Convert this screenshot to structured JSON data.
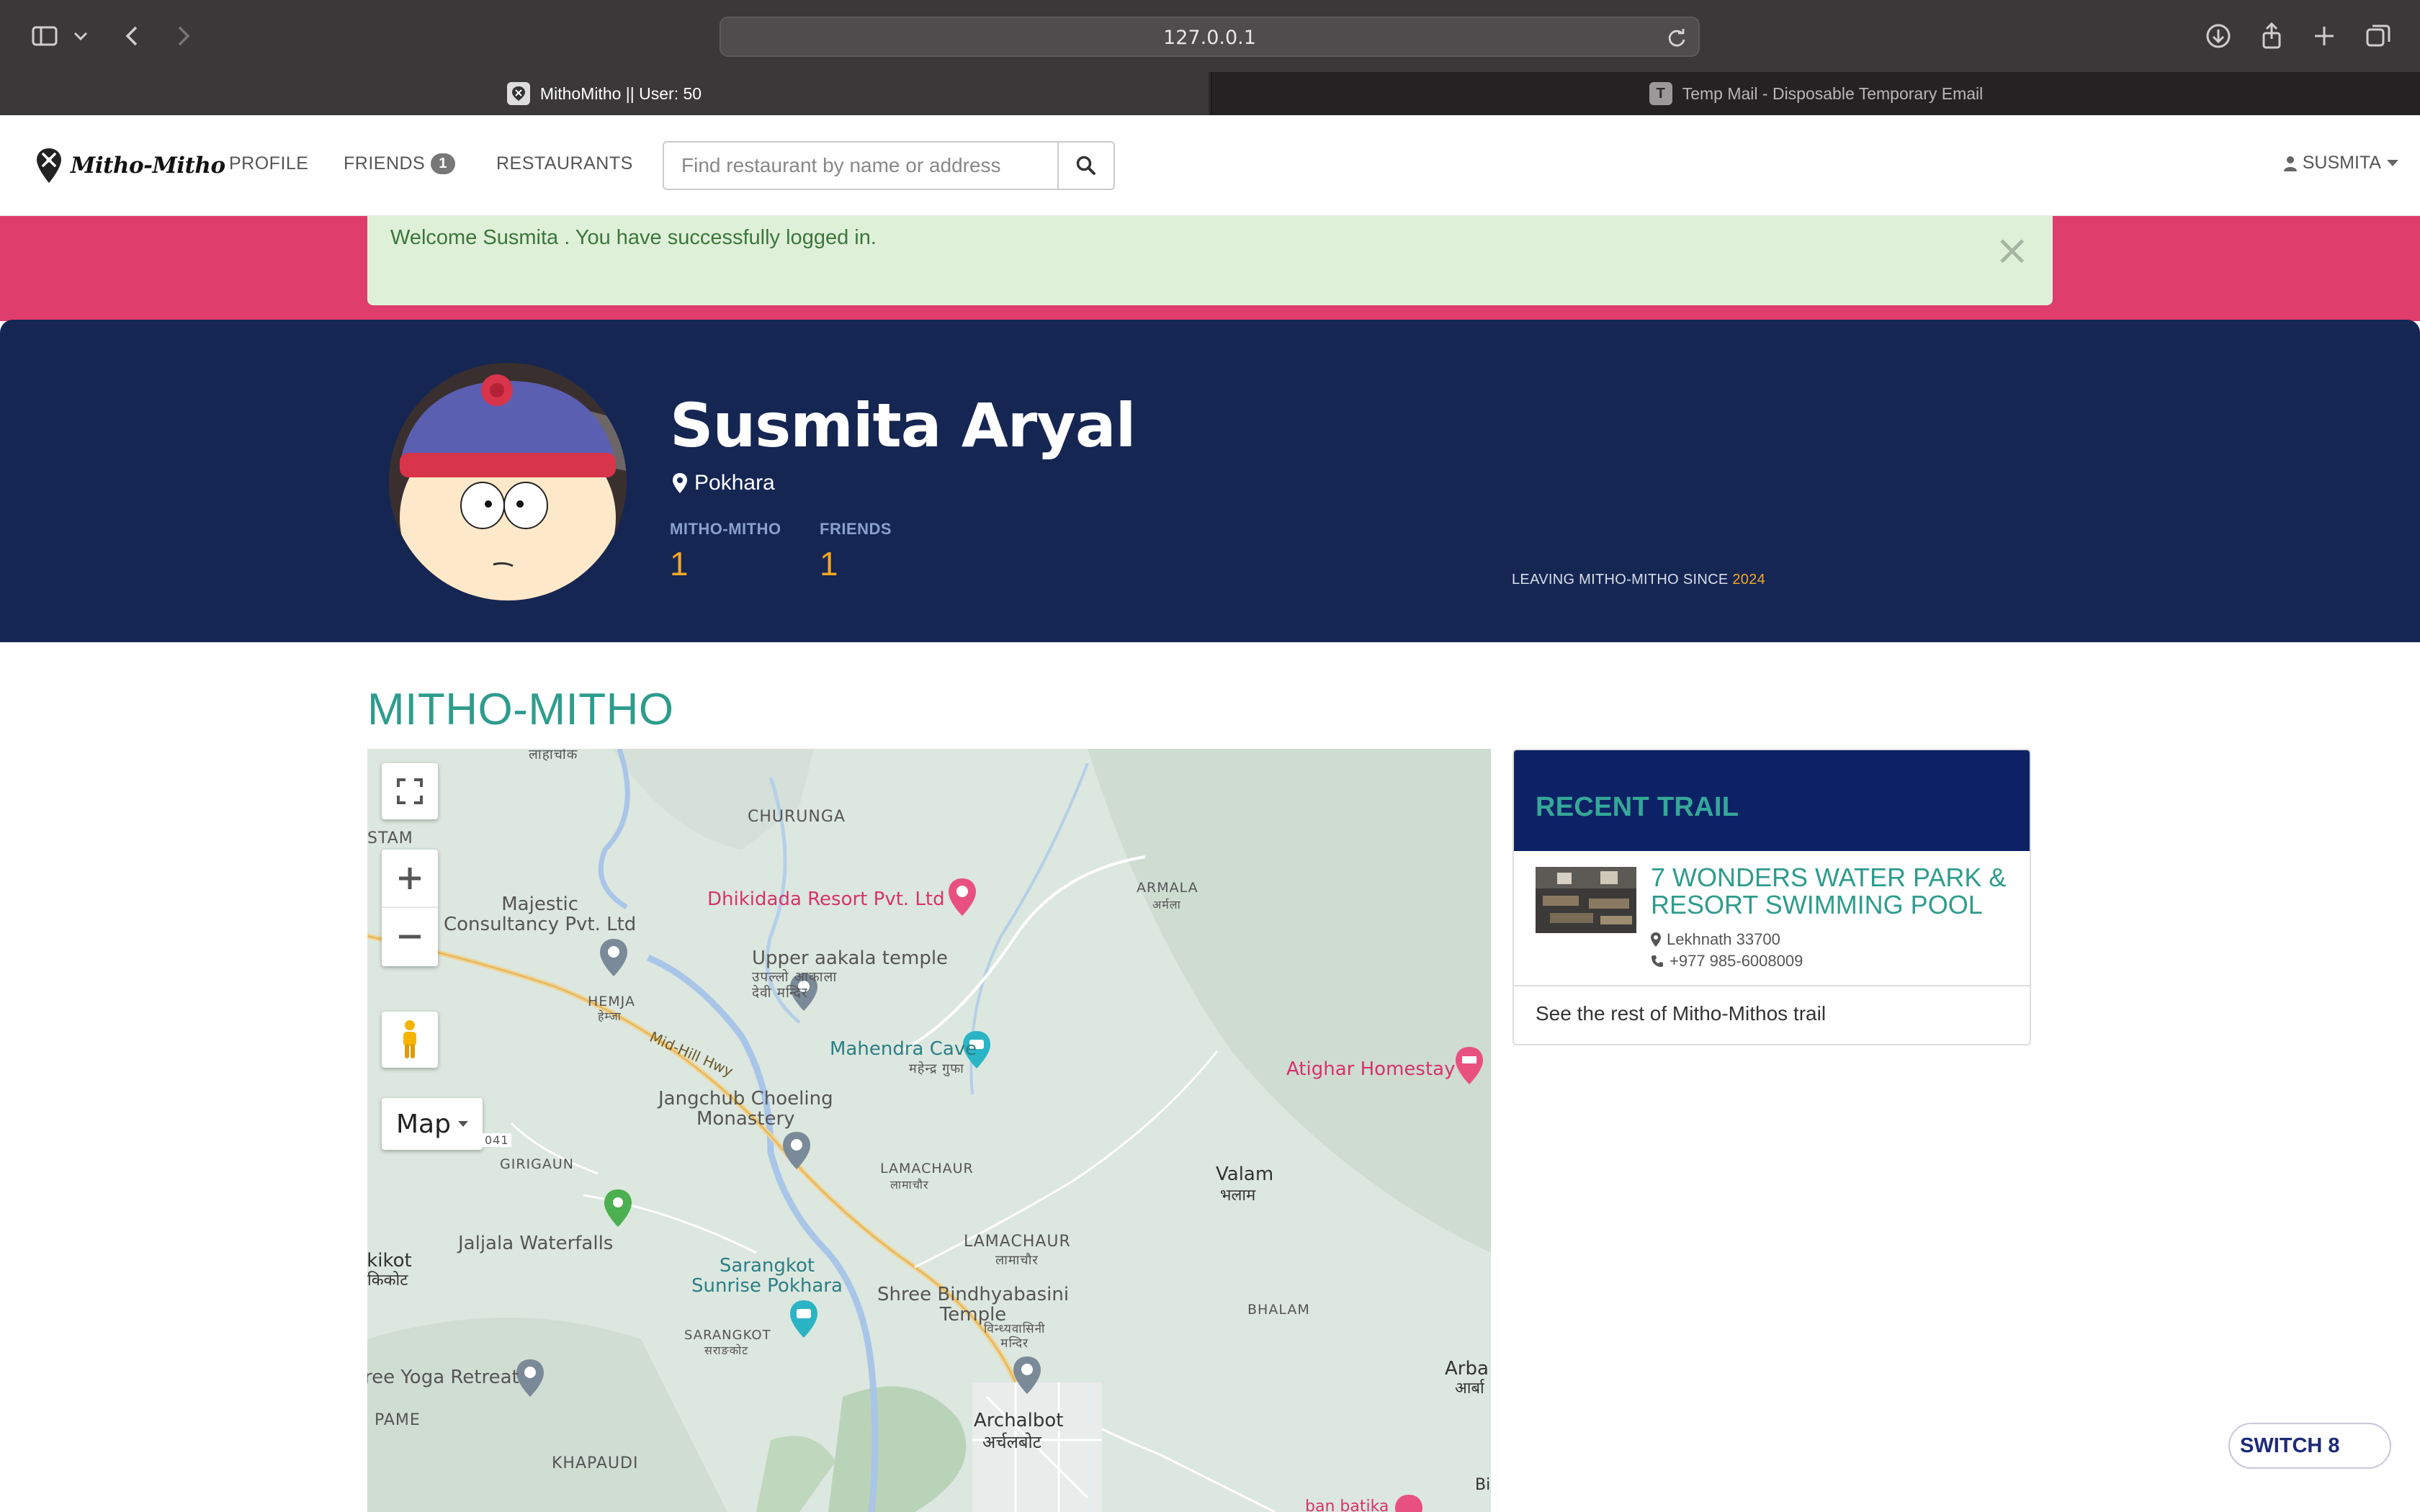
{
  "browser": {
    "url": "127.0.0.1",
    "tabs": [
      {
        "title": "MithoMitho || User: 50",
        "active": true
      },
      {
        "title": "Temp Mail - Disposable Temporary Email",
        "active": false,
        "favicon_letter": "T"
      }
    ]
  },
  "navbar": {
    "brand": "Mitho-Mitho",
    "links": {
      "profile": "PROFILE",
      "friends": "FRIENDS",
      "restaurants": "RESTAURANTS"
    },
    "friends_badge": "1",
    "search_placeholder": "Find restaurant by name or address",
    "user": "SUSMITA"
  },
  "alert": {
    "message": "Welcome Susmita . You have successfully logged in.",
    "close": "×"
  },
  "profile": {
    "name": "Susmita Aryal",
    "location": "Pokhara",
    "stats": [
      {
        "label": "MITHO-MITHO",
        "value": "1"
      },
      {
        "label": "FRIENDS",
        "value": "1"
      }
    ],
    "since_text": "LEAVING MITHO-MITHO SINCE",
    "since_year": "2024"
  },
  "section": {
    "title": "MITHO-MITHO"
  },
  "map": {
    "type_button": "Map",
    "labels": {
      "lahachok": "लाहाचोक",
      "churunga": "CHURUNGA",
      "stam": "STAM",
      "majestic": "Majestic\nConsultancy Pvt. Ltd",
      "dhikidada": "Dhikidada Resort Pvt. Ltd",
      "armala": "ARMALA",
      "armala_dev": "अर्मला",
      "upper_aakala": "Upper aakala temple",
      "upper_aakala_dev": "उपल्लो आकाला\nदेवी मन्दिर",
      "hemja": "HEMJA",
      "hemja_dev": "हेम्जा",
      "mahendra_cave": "Mahendra Cave",
      "mahendra_cave_dev": "महेन्द्र गुफा",
      "mid_hill": "Mid-Hill Hwy",
      "atighar": "Atighar Homestay",
      "jangchub": "Jangchub Choeling\nMonastery",
      "road_041": "041",
      "girigaun": "GIRIGAUN",
      "lamachaur_small": "LAMACHAUR",
      "lamachaur_small_dev": "लामाचौर",
      "valam": "Valam",
      "valam_dev": "भलाम",
      "lamachaur": "LAMACHAUR",
      "lamachaur_dev": "लामाचौर",
      "jaljala": "Jaljala Waterfalls",
      "kikot": "ikikot",
      "kikot_dev": "किकोट",
      "sarangkot_sunrise": "Sarangkot\nSunrise Pokhara",
      "bindhyabasini": "Shree Bindhyabasini\nTemple",
      "bindhyabasini_dev": "विन्ध्यवासिनी\nमन्दिर",
      "bhalam": "BHALAM",
      "sarangkot": "SARANGKOT",
      "sarangkot_dev": "सराङकोट",
      "yoga": "ree Yoga Retreat",
      "arba": "Arba",
      "arba_dev": "आर्बा",
      "pame": "PAME",
      "archalbot": "Archalbot",
      "archalbot_dev": "अर्चलबोट",
      "khapaudi": "KHAPAUDI",
      "ban_batika": "ban batika",
      "bi": "Bi"
    }
  },
  "trail": {
    "title": "RECENT TRAIL",
    "item": {
      "name": "7 WONDERS WATER PARK & RESORT SWIMMING POOL",
      "address": "Lekhnath 33700",
      "phone": "+977 985-6008009"
    },
    "more": "See the rest of Mitho-Mithos trail"
  },
  "floating": {
    "switch_label": "SWITCH 8"
  },
  "colors": {
    "accent_teal": "#2e9c8d",
    "profile_bg": "#162653",
    "alert_band": "#df3d6c",
    "alert_bg": "#dff0d8",
    "stat_orange": "#f5a623"
  }
}
